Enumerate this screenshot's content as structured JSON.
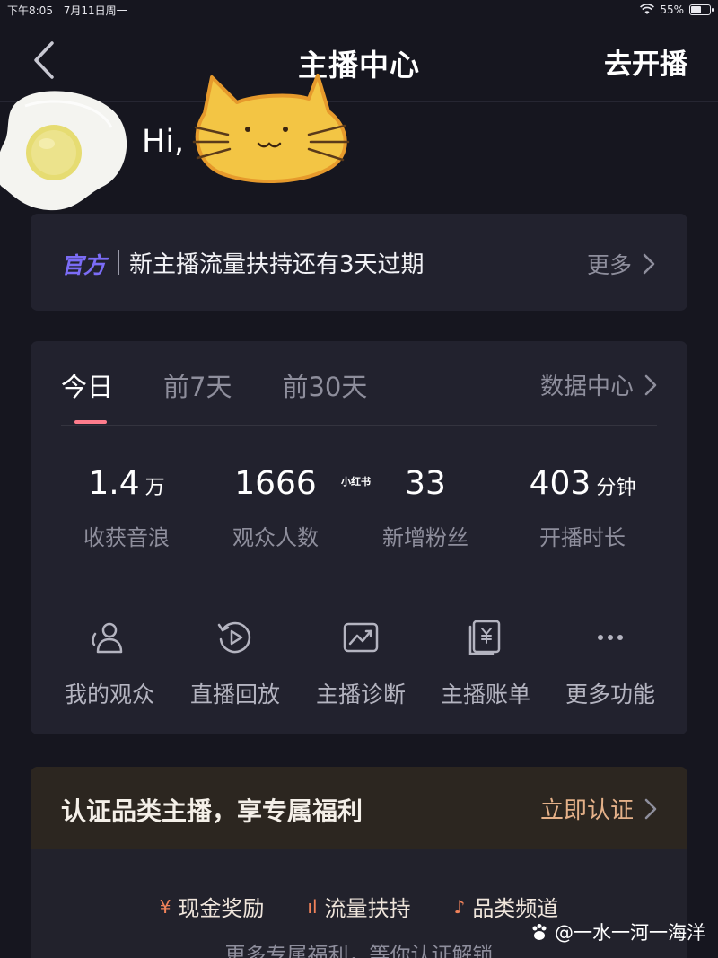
{
  "status": {
    "time": "下午8:05",
    "date": "7月11日周一",
    "battery": "55%",
    "battery_level": 0.55
  },
  "header": {
    "title": "主播中心",
    "go_live": "去开播"
  },
  "greeting": {
    "hi": "Hi,"
  },
  "notice": {
    "tag": "官方",
    "message": "新主播流量扶持还有3天过期",
    "more": "更多"
  },
  "stats": {
    "tabs": [
      "今日",
      "前7天",
      "前30天"
    ],
    "data_center": "数据中心",
    "metrics": [
      {
        "value": "1.4",
        "unit": "万",
        "label": "收获音浪"
      },
      {
        "value": "1666",
        "unit": "",
        "label": "观众人数"
      },
      {
        "value": "33",
        "unit": "",
        "label": "新增粉丝"
      },
      {
        "value": "403",
        "unit": "分钟",
        "label": "开播时长"
      }
    ],
    "watermark": "小红书",
    "tools": [
      {
        "label": "我的观众",
        "icon": "audience-icon"
      },
      {
        "label": "直播回放",
        "icon": "replay-icon"
      },
      {
        "label": "主播诊断",
        "icon": "diagnosis-icon"
      },
      {
        "label": "主播账单",
        "icon": "bill-icon"
      },
      {
        "label": "更多功能",
        "icon": "more-dots-icon"
      }
    ]
  },
  "promo": {
    "title": "认证品类主播，享专属福利",
    "cta": "立即认证",
    "perks": [
      {
        "icon": "¥",
        "label": "现金奖励"
      },
      {
        "icon": "ıl",
        "label": "流量扶持"
      },
      {
        "icon": "♪",
        "label": "品类频道"
      }
    ],
    "sub": "更多专属福利，等你认证解锁"
  },
  "credit": "@一水一河一海洋",
  "colors": {
    "accent_tab": "#fe7c8c",
    "official_tag": "#7b6cf6",
    "promo_cta": "#e5b189",
    "background": "#16161f"
  }
}
